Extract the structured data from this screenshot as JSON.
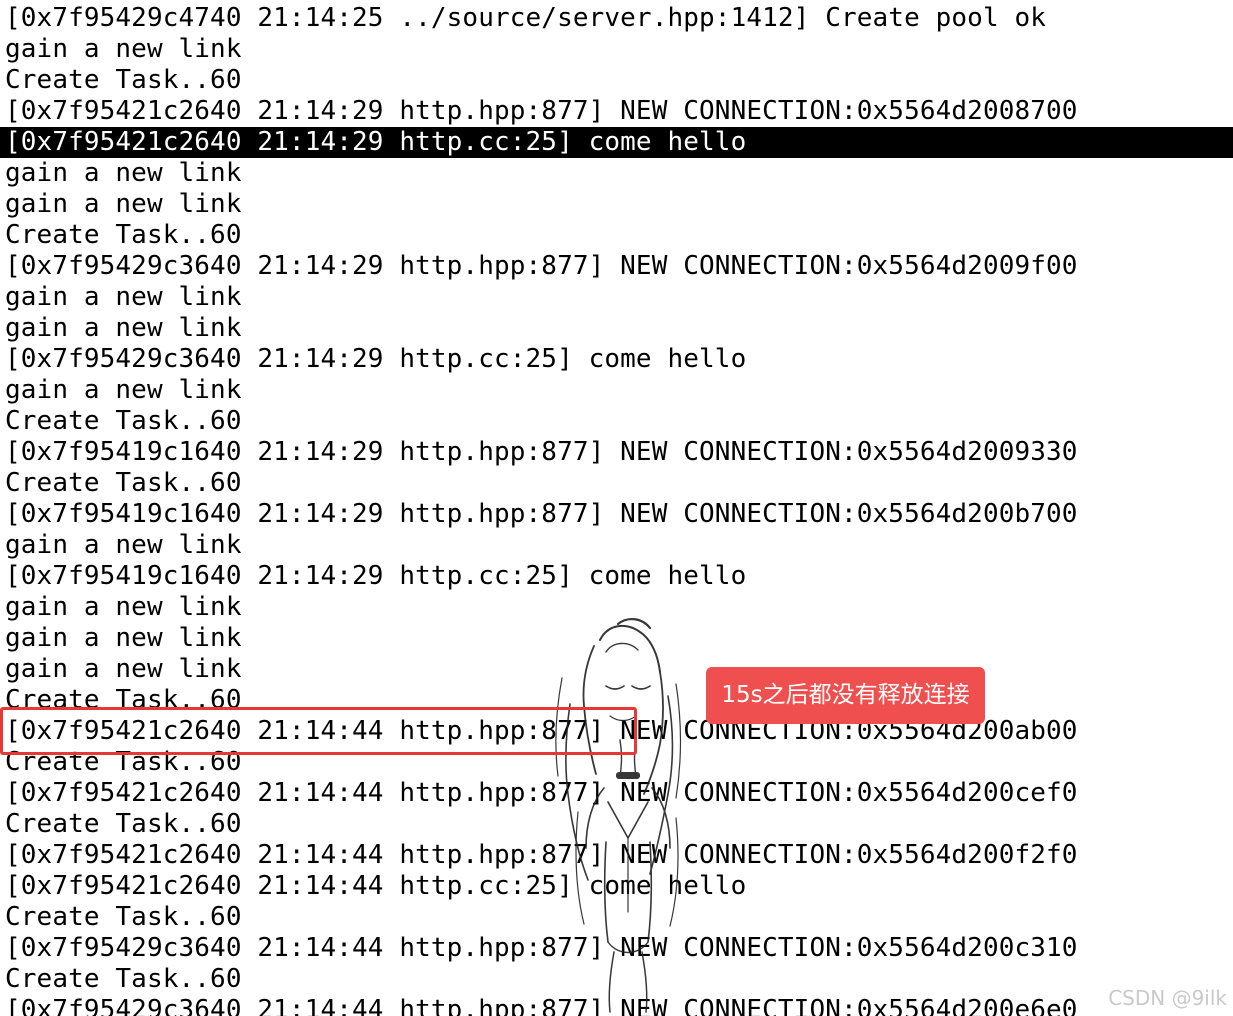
{
  "terminal": {
    "lines": [
      "[0x7f95429c4740 21:14:25 ../source/server.hpp:1412] Create pool ok",
      "gain a new link",
      "Create Task..60",
      "[0x7f95421c2640 21:14:29 http.hpp:877] NEW CONNECTION:0x5564d2008700",
      "[0x7f95421c2640 21:14:29 http.cc:25] come hello",
      "gain a new link",
      "gain a new link",
      "Create Task..60",
      "[0x7f95429c3640 21:14:29 http.hpp:877] NEW CONNECTION:0x5564d2009f00",
      "gain a new link",
      "gain a new link",
      "[0x7f95429c3640 21:14:29 http.cc:25] come hello",
      "gain a new link",
      "Create Task..60",
      "[0x7f95419c1640 21:14:29 http.hpp:877] NEW CONNECTION:0x5564d2009330",
      "Create Task..60",
      "[0x7f95419c1640 21:14:29 http.hpp:877] NEW CONNECTION:0x5564d200b700",
      "gain a new link",
      "[0x7f95419c1640 21:14:29 http.cc:25] come hello",
      "gain a new link",
      "gain a new link",
      "gain a new link",
      "Create Task..60",
      "[0x7f95421c2640 21:14:44 http.hpp:877] NEW CONNECTION:0x5564d200ab00",
      "Create Task..60",
      "[0x7f95421c2640 21:14:44 http.hpp:877] NEW CONNECTION:0x5564d200cef0",
      "Create Task..60",
      "[0x7f95421c2640 21:14:44 http.hpp:877] NEW CONNECTION:0x5564d200f2f0",
      "[0x7f95421c2640 21:14:44 http.cc:25] come hello",
      "Create Task..60",
      "[0x7f95429c3640 21:14:44 http.hpp:877] NEW CONNECTION:0x5564d200c310",
      "Create Task..60",
      "[0x7f95429c3640 21:14:44 http.hpp:877] NEW CONNECTION:0x5564d200e6e0"
    ],
    "selected_line_index": 4,
    "highlighted_line_index": 23
  },
  "annotation": {
    "text": "15s之后都没有释放连接"
  },
  "watermark": {
    "text": "CSDN @9ilk"
  },
  "colors": {
    "terminal_background": "#ffffff",
    "terminal_text": "#000000",
    "selection_background": "#000000",
    "selection_text": "#ffffff",
    "highlight_border": "#e53935",
    "annotation_background": "#ef4f4f",
    "annotation_text": "#ffffff",
    "watermark_text": "#c9c9c9"
  },
  "icons": {
    "background_sketch": "anime-girl-sketch"
  }
}
